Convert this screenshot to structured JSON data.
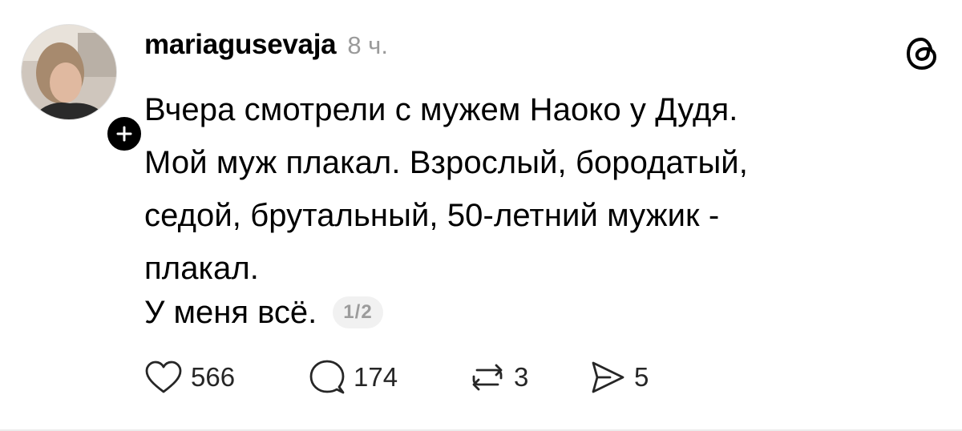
{
  "post": {
    "author": {
      "username": "mariagusevaja",
      "time": "8 ч."
    },
    "text_lines": [
      "Вчера смотрели с мужем Наоко у Дудя.",
      "Мой муж плакал. Взрослый, бородатый,",
      "седой, брутальный, 50-летний мужик -",
      "плакал."
    ],
    "text_line2": "У меня всё.",
    "page_indicator": "1/2",
    "actions": {
      "likes": "566",
      "replies": "174",
      "reposts": "3",
      "shares": "5"
    }
  },
  "icons": {
    "avatar": "avatar",
    "follow": "plus-icon",
    "logo": "threads-logo-icon",
    "like": "heart-icon",
    "reply": "comment-icon",
    "repost": "repost-icon",
    "share": "send-icon"
  },
  "colors": {
    "text": "#000000",
    "muted": "#9a9a9a",
    "pill_bg": "#f1f1f1"
  }
}
